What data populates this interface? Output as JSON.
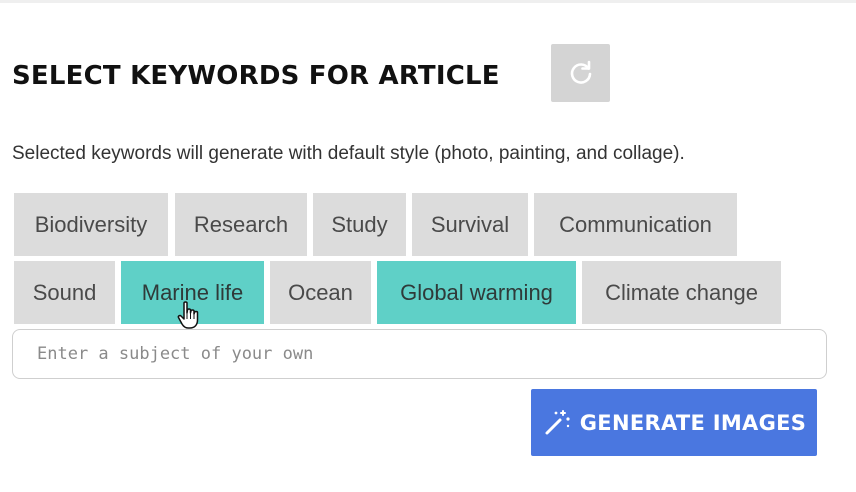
{
  "header": {
    "title": "SELECT KEYWORDS FOR ARTICLE",
    "refresh_icon": "refresh-icon"
  },
  "description": "Selected keywords will generate with default style (photo, painting, and collage).",
  "keywords": [
    {
      "label": "Biodiversity",
      "selected": false
    },
    {
      "label": "Research",
      "selected": false
    },
    {
      "label": "Study",
      "selected": false
    },
    {
      "label": "Survival",
      "selected": false
    },
    {
      "label": "Communication",
      "selected": false
    },
    {
      "label": "Sound",
      "selected": false
    },
    {
      "label": "Marine life",
      "selected": true
    },
    {
      "label": "Ocean",
      "selected": false
    },
    {
      "label": "Global warming",
      "selected": true
    },
    {
      "label": "Climate change",
      "selected": false
    }
  ],
  "subject_input": {
    "placeholder": "Enter a subject of your own",
    "value": ""
  },
  "generate_button": {
    "label": "GENERATE IMAGES",
    "icon": "magic-wand-icon"
  },
  "colors": {
    "selected_chip": "#5fd0c7",
    "unselected_chip": "#dcdcdc",
    "generate_button": "#4a77e0",
    "refresh_button": "#d4d4d4"
  }
}
